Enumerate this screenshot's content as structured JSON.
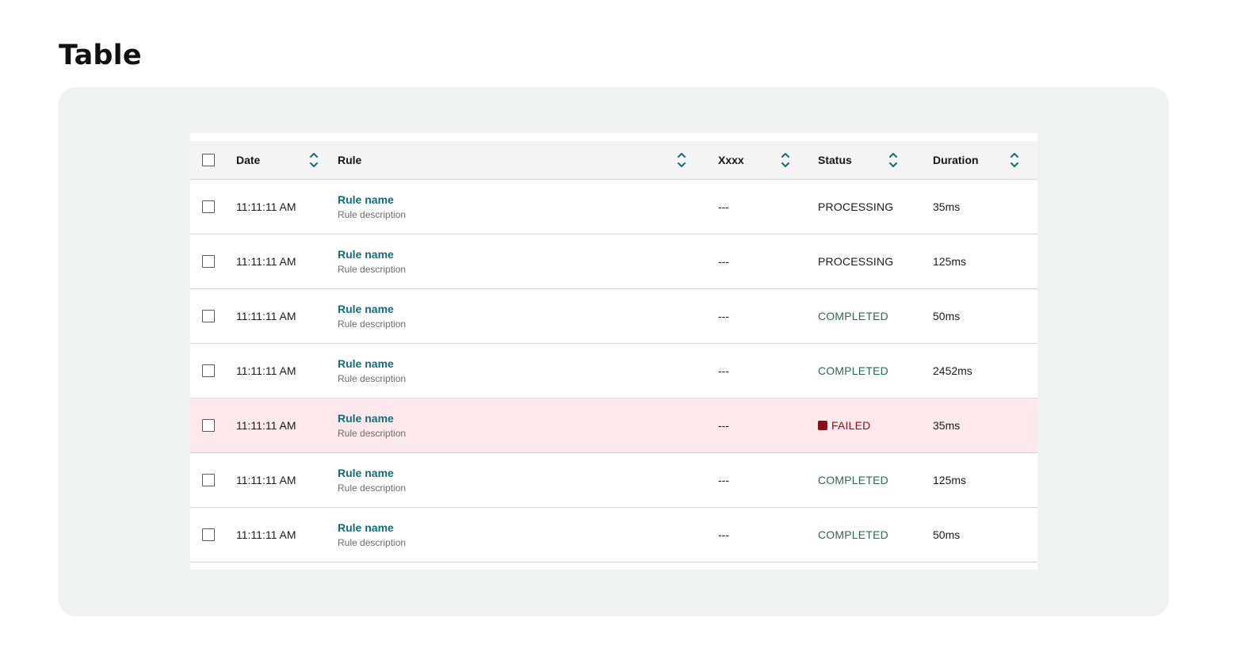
{
  "page": {
    "title": "Table"
  },
  "table": {
    "columns": [
      {
        "label": "Date",
        "sortable": true
      },
      {
        "label": "Rule",
        "sortable": true
      },
      {
        "label": "Xxxx",
        "sortable": true
      },
      {
        "label": "Status",
        "sortable": true
      },
      {
        "label": "Duration",
        "sortable": true
      }
    ],
    "rows": [
      {
        "date": "11:11:11 AM",
        "rule_name": "Rule name",
        "rule_description": "Rule description",
        "xxxx": "---",
        "status": "PROCESSING",
        "duration": "35ms"
      },
      {
        "date": "11:11:11 AM",
        "rule_name": "Rule name",
        "rule_description": "Rule description",
        "xxxx": "---",
        "status": "PROCESSING",
        "duration": "125ms"
      },
      {
        "date": "11:11:11 AM",
        "rule_name": "Rule name",
        "rule_description": "Rule description",
        "xxxx": "---",
        "status": "COMPLETED",
        "duration": "50ms"
      },
      {
        "date": "11:11:11 AM",
        "rule_name": "Rule name",
        "rule_description": "Rule description",
        "xxxx": "---",
        "status": "COMPLETED",
        "duration": "2452ms"
      },
      {
        "date": "11:11:11 AM",
        "rule_name": "Rule name",
        "rule_description": "Rule description",
        "xxxx": "---",
        "status": "FAILED",
        "duration": "35ms"
      },
      {
        "date": "11:11:11 AM",
        "rule_name": "Rule name",
        "rule_description": "Rule description",
        "xxxx": "---",
        "status": "COMPLETED",
        "duration": "125ms"
      },
      {
        "date": "11:11:11 AM",
        "rule_name": "Rule name",
        "rule_description": "Rule description",
        "xxxx": "---",
        "status": "COMPLETED",
        "duration": "50ms"
      }
    ]
  },
  "icons": {
    "sort": "sort-up-down-icon",
    "failed": "failed-square-icon",
    "checkbox": "checkbox-icon"
  },
  "colors": {
    "accent": "#0f6d7d",
    "completed": "#2a6b48",
    "failed": "#8a0f18",
    "failed_row_bg": "#fde9ec",
    "canvas_bg": "#eef2f1"
  }
}
